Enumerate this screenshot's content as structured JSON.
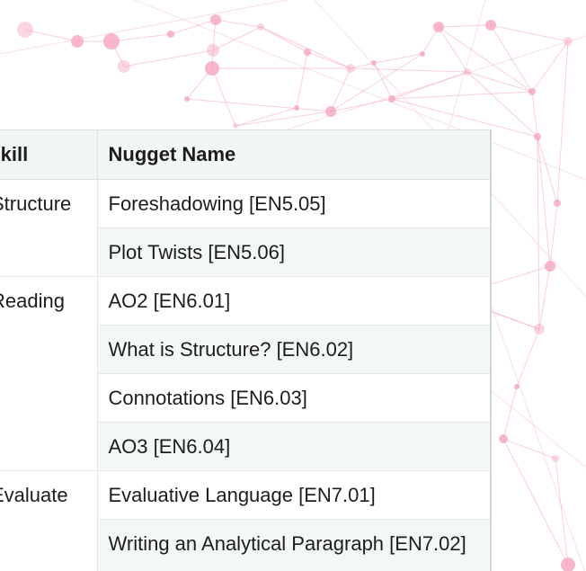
{
  "table": {
    "headers": {
      "skill": "Skill",
      "nugget": "Nugget Name"
    },
    "groups": [
      {
        "skill": "Structure",
        "nuggets": [
          "Foreshadowing [EN5.05]",
          "Plot Twists [EN5.06]"
        ]
      },
      {
        "skill": "Reading",
        "nuggets": [
          "AO2 [EN6.01]",
          "What is Structure? [EN6.02]",
          "Connotations [EN6.03]",
          "AO3 [EN6.04]"
        ]
      },
      {
        "skill": "Evaluate",
        "nuggets": [
          "Evaluative Language [EN7.01]",
          "Writing an Analytical Paragraph [EN7.02]"
        ]
      }
    ]
  },
  "colors": {
    "network_pink": "#f4a6bd",
    "header_bg": "#f2f6f5",
    "alt_row_bg": "#f3f7f6",
    "text": "#1d1d1f"
  }
}
